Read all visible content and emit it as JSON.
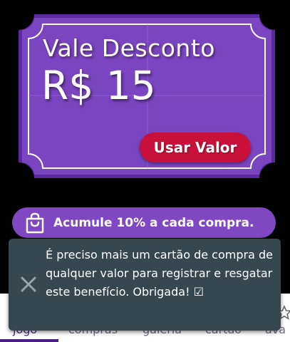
{
  "voucher": {
    "title": "Vale Desconto",
    "value": "R$ 15",
    "button_label": "Usar Valor"
  },
  "benefit": {
    "text": "Acumule 10% a cada compra.",
    "icon": "shopping-bag-icon"
  },
  "bottom_nav": {
    "tabs": [
      {
        "label": "jogo",
        "active": true
      },
      {
        "label": "compras",
        "active": false
      },
      {
        "label": "galeria",
        "active": false
      },
      {
        "label": "cartão",
        "active": false
      },
      {
        "label": "ava",
        "active": false
      }
    ],
    "icon": "star-icon"
  },
  "toast": {
    "message": "É preciso mais um cartão de compra de qualquer valor para registrar e resgatar este benefício. Obrigada! ☑",
    "close_icon": "close-icon"
  },
  "colors": {
    "voucher_bg": "#7a45c0",
    "voucher_border": "#5b2aa0",
    "button": "#c8103a",
    "pill": "#7f47c2",
    "toast": "#37474f",
    "background": "#000000"
  }
}
